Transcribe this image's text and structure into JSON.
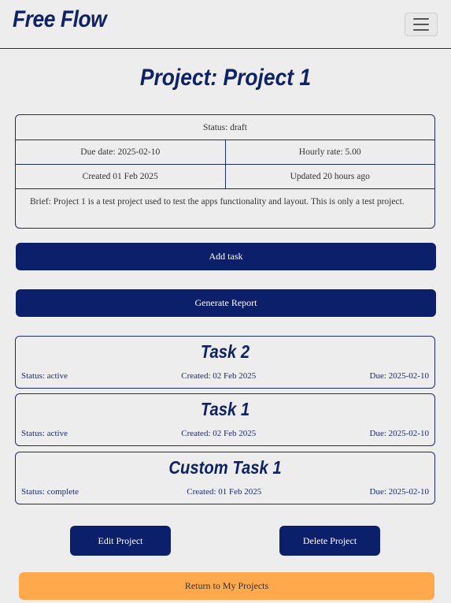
{
  "navbar": {
    "brand": "Free Flow",
    "toggler_icon": "hamburger-menu-icon"
  },
  "project": {
    "title": "Project: Project 1",
    "status": "Status: draft",
    "due_date": "Due date: 2025-02-10",
    "hourly_rate": "Hourly rate: 5.00",
    "created": "Created 01 Feb 2025",
    "updated": "Updated 20 hours ago",
    "brief": "Brief: Project 1 is a test project used to test the apps functionality and layout. This is only a test project."
  },
  "actions": {
    "add_task": "Add task",
    "generate_report": "Generate Report",
    "edit_project": "Edit Project",
    "delete_project": "Delete Project",
    "return": "Return to My Projects"
  },
  "tasks": [
    {
      "title": "Task 2",
      "status": "Status: active",
      "created": "Created: 02 Feb 2025",
      "due": "Due: 2025-02-10"
    },
    {
      "title": "Task 1",
      "status": "Status: active",
      "created": "Created: 02 Feb 2025",
      "due": "Due: 2025-02-10"
    },
    {
      "title": "Custom Task 1",
      "status": "Status: complete",
      "created": "Created: 01 Feb 2025",
      "due": "Due: 2025-02-10"
    }
  ],
  "colors": {
    "primary": "#0c1f6b",
    "accent": "#ffa84c",
    "background": "#eeedee"
  }
}
